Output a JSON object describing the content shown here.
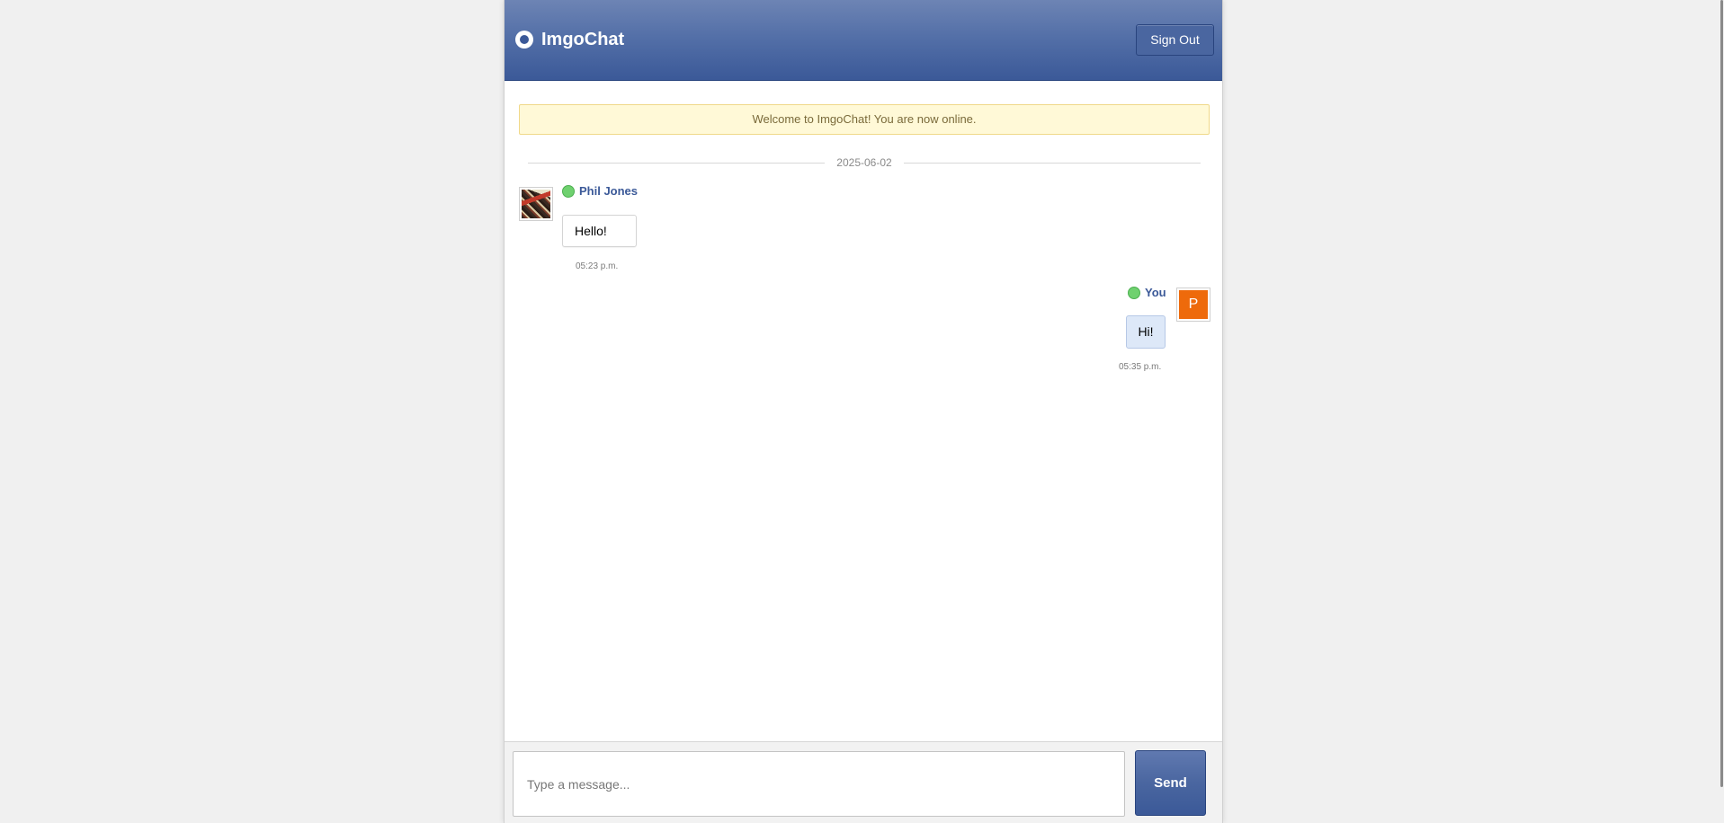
{
  "header": {
    "title": "ImgoChat",
    "signout_label": "Sign Out"
  },
  "notice": {
    "text": "Welcome to ImgoChat! You are now online."
  },
  "conversation": {
    "date": "2025-06-02",
    "messages": [
      {
        "sender": "Phil Jones",
        "text": "Hello!",
        "time": "05:23 p.m.",
        "direction": "incoming",
        "status": "online"
      },
      {
        "sender": "You",
        "avatar_letter": "P",
        "text": "Hi!",
        "time": "05:35 p.m.",
        "direction": "outgoing",
        "status": "online"
      }
    ]
  },
  "composer": {
    "placeholder": "Type a message...",
    "value": "",
    "send_label": "Send"
  },
  "colors": {
    "brand": "#3b5998",
    "online": "#6fd16f",
    "avatar_letter_bg": "#ee6a0b",
    "notice_bg": "#fff9d7",
    "outgoing_bubble": "#dde8f8"
  }
}
